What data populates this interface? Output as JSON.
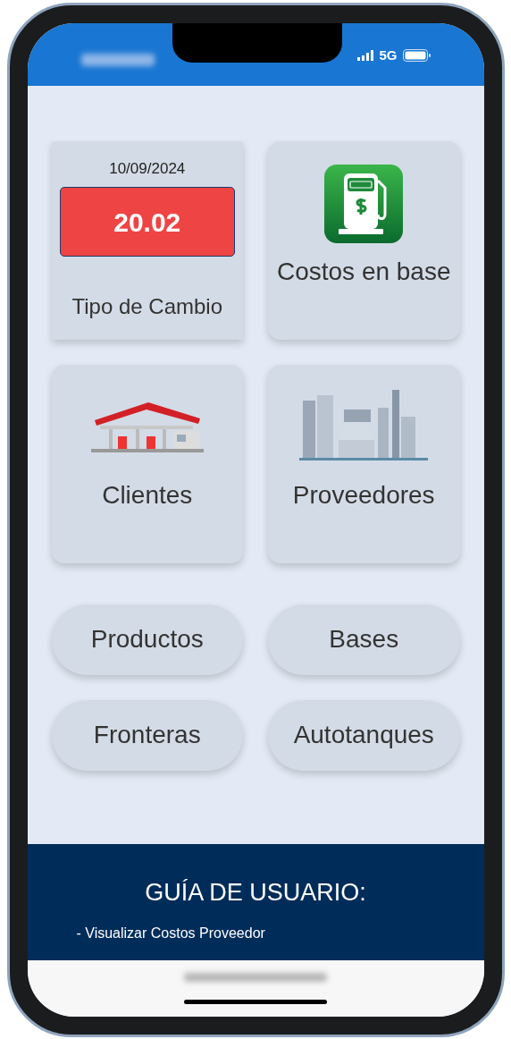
{
  "status_bar": {
    "network": "5G"
  },
  "cards": [
    {
      "kind": "rate",
      "date": "10/09/2024",
      "value": "20.02",
      "label": "Tipo de Cambio"
    },
    {
      "label": "Costos en base"
    },
    {
      "label": "Clientes"
    },
    {
      "label": "Proveedores"
    }
  ],
  "buttons": [
    "Productos",
    "Bases",
    "Fronteras",
    "Autotanques"
  ],
  "guide": {
    "title": "GUÍA DE USUARIO:",
    "items": [
      "- Visualizar Costos Proveedor"
    ]
  }
}
